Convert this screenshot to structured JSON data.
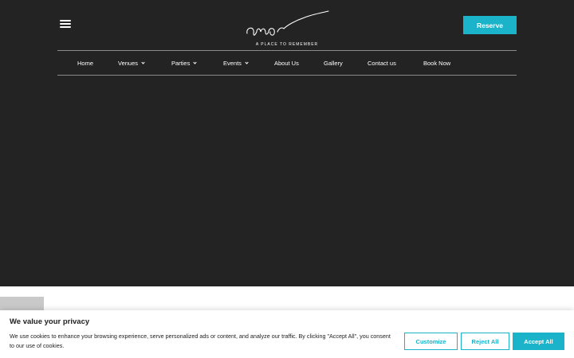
{
  "header": {
    "logo_text": "amor",
    "logo_tagline": "A PLACE TO REMEMBER",
    "reserve_label": "Reserve"
  },
  "nav": {
    "items": [
      {
        "label": "Home",
        "has_dropdown": false
      },
      {
        "label": "Venues",
        "has_dropdown": true
      },
      {
        "label": "Parties",
        "has_dropdown": true
      },
      {
        "label": "Events",
        "has_dropdown": true
      },
      {
        "label": "About Us",
        "has_dropdown": false
      },
      {
        "label": "Gallery",
        "has_dropdown": false
      },
      {
        "label": "Contact us",
        "has_dropdown": false
      },
      {
        "label": "Book Now",
        "has_dropdown": false
      }
    ]
  },
  "cookie_banner": {
    "title": "We value your privacy",
    "text": "We use cookies to enhance your browsing experience, serve personalized ads or content, and analyze our traffic. By clicking \"Accept All\", you consent to our use of cookies.",
    "customize_label": "Customize",
    "reject_label": "Reject All",
    "accept_label": "Accept All"
  },
  "colors": {
    "hero_background": "#232323",
    "accent": "#1bb3c9",
    "text_light": "#ffffff",
    "text_dark": "#212121"
  },
  "icons": {
    "menu": "hamburger-icon",
    "dropdown": "chevron-down-icon"
  }
}
